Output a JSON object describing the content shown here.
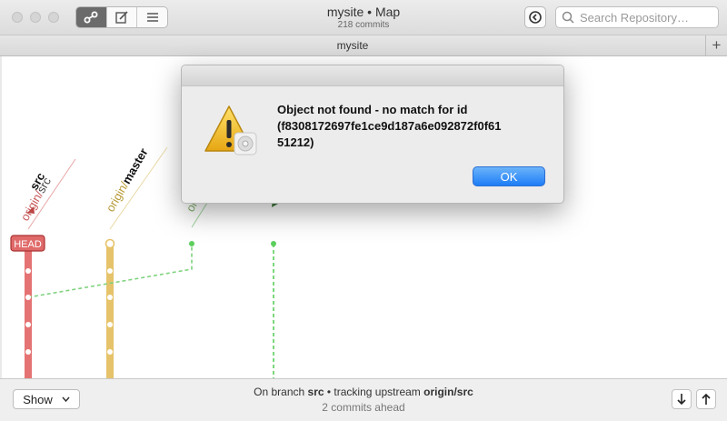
{
  "window": {
    "title": "mysite • Map",
    "subtitle": "218 commits",
    "search_placeholder": "Search Repository…"
  },
  "tabs": [
    {
      "label": "mysite"
    }
  ],
  "branch_labels": {
    "src": {
      "local": "src",
      "remote_prefix": "origin/",
      "remote_name": "src"
    },
    "master": {
      "remote_prefix": "origin/",
      "name": "master"
    },
    "third_partial": "or",
    "head_badge": "HEAD"
  },
  "colors": {
    "src_lane": "#e57373",
    "master_lane": "#e6c36a",
    "green_lane": "#5ccf5c",
    "dialog_button": "#1d7df6"
  },
  "dialog": {
    "message": "Object not found - no match for id\n(f8308172697fe1ce9d187a6e092872f0f61\n51212)",
    "ok_label": "OK",
    "icon": "warning-icon"
  },
  "bottom_bar": {
    "show_label": "Show",
    "status_prefix": "On branch ",
    "branch": "src",
    "status_middle": " • tracking upstream ",
    "upstream": "origin/src",
    "ahead": "2 commits ahead"
  },
  "icons": [
    "graph-view-icon",
    "edit-icon",
    "list-icon",
    "history-icon",
    "search-icon",
    "add-tab-icon",
    "pull-icon",
    "push-icon"
  ]
}
